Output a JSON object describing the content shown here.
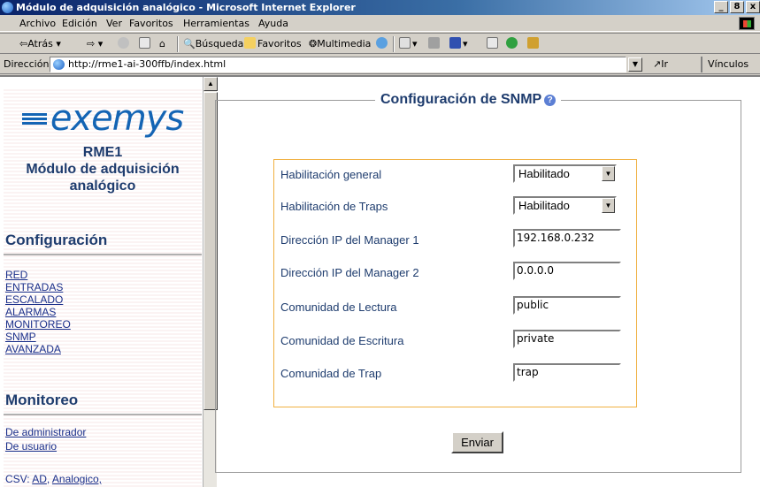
{
  "window": {
    "title": "Módulo de adquisición analógico - Microsoft Internet Explorer",
    "buttons": [
      "_",
      "8",
      "x"
    ]
  },
  "menu": [
    "Archivo",
    "Edición",
    "Ver",
    "Favoritos",
    "Herramientas",
    "Ayuda"
  ],
  "toolbar": {
    "back": "Atrás",
    "search": "Búsqueda",
    "favorites": "Favoritos",
    "multimedia": "Multimedia"
  },
  "address": {
    "label": "Dirección",
    "url": "http://rme1-ai-300ffb/index.html",
    "go": "Ir",
    "links": "Vínculos"
  },
  "sidebar": {
    "brand": "exemys",
    "device_lines": [
      "RME1",
      "Módulo de adquisición",
      "analógico"
    ],
    "config_heading": "Configuración",
    "config_links": [
      "RED",
      "ENTRADAS",
      "ESCALADO",
      "ALARMAS",
      "MONITOREO",
      "SNMP",
      "AVANZADA"
    ],
    "monitor_heading": "Monitoreo",
    "monitor_links": [
      "De administrador",
      "De usuario"
    ],
    "csv_prefix": "CSV:",
    "csv_links": [
      "AD",
      "Analogico,"
    ]
  },
  "form": {
    "legend": "Configuración de SNMP",
    "rows": [
      {
        "label": "Habilitación general",
        "value": "Habilitado",
        "type": "select"
      },
      {
        "label": "Habilitación de Traps",
        "value": "Habilitado",
        "type": "select"
      },
      {
        "label": "Dirección IP del Manager 1",
        "value": "192.168.0.232",
        "type": "text"
      },
      {
        "label": "Dirección IP del Manager 2",
        "value": "0.0.0.0",
        "type": "text"
      },
      {
        "label": "Comunidad de Lectura",
        "value": "public",
        "type": "text"
      },
      {
        "label": "Comunidad de Escritura",
        "value": "private",
        "type": "text"
      },
      {
        "label": "Comunidad de Trap",
        "value": "trap",
        "type": "text"
      }
    ],
    "submit": "Enviar"
  },
  "colors": {
    "brand": "#1464b4",
    "heading": "#1e3c6e",
    "link": "#1a2f8a",
    "form_border": "#f0b040"
  }
}
